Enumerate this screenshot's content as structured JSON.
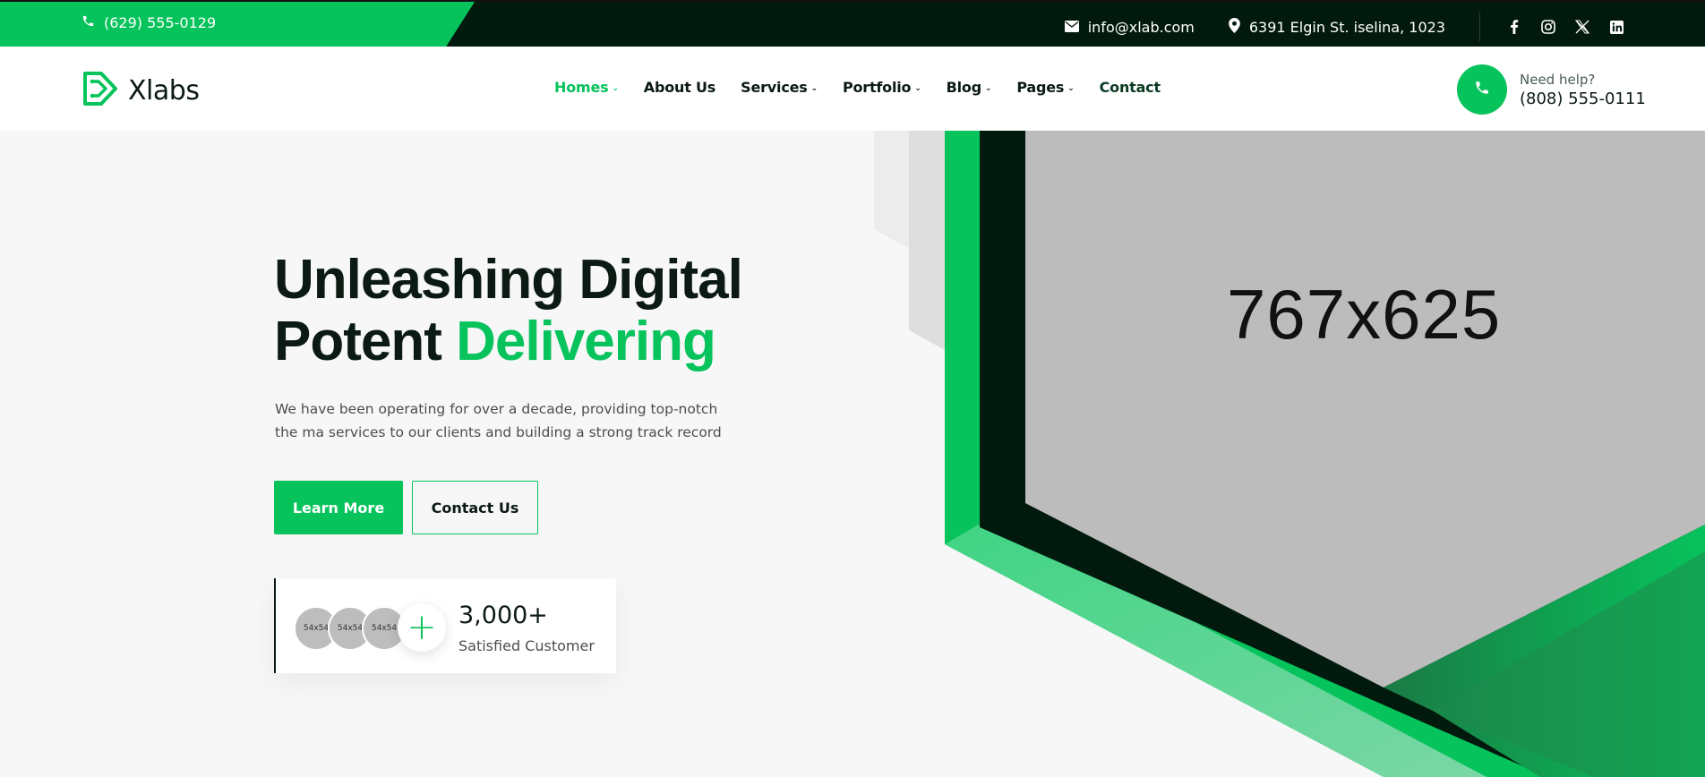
{
  "topbar": {
    "phone": "(629) 555-0129",
    "email": "info@xlab.com",
    "address": "6391 Elgin St. iselina, 1023",
    "social": [
      "facebook-icon",
      "instagram-icon",
      "x-icon",
      "linkedin-icon"
    ]
  },
  "header": {
    "logo_text": "Xlabs",
    "nav": [
      {
        "label": "Homes",
        "active": true
      },
      {
        "label": "About Us"
      },
      {
        "label": "Services"
      },
      {
        "label": "Portfolio"
      },
      {
        "label": "Blog"
      },
      {
        "label": "Pages"
      },
      {
        "label": "Contact"
      }
    ],
    "help_label": "Need help?",
    "help_phone": "(808) 555-0111"
  },
  "hero": {
    "title_line1": "Unleashing Digital",
    "title_line2_plain": "Potent ",
    "title_line2_highlight": "Delivering",
    "description": "We have been operating for over a decade, providing top-notch the ma services to our clients and building a strong track record",
    "primary_button": "Learn More",
    "secondary_button": "Contact Us",
    "avatars": [
      "54x54",
      "54x54",
      "54x54"
    ],
    "stat_number": "3,000+",
    "stat_label": "Satisfied Customer",
    "image_placeholder": "767x625"
  },
  "colors": {
    "accent": "#07c35c",
    "dark": "#021a0e",
    "placeholder": "#bdbdbd"
  }
}
